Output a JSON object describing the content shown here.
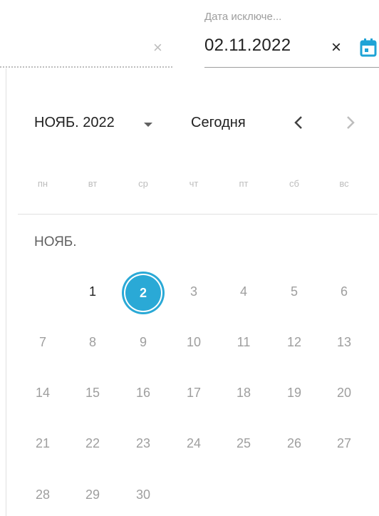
{
  "field": {
    "label": "Дата исключе...",
    "value": "02.11.2022",
    "clear_glyph": "×",
    "prev_clear_glyph": "×",
    "calendar_icon": "calendar-icon"
  },
  "picker": {
    "month_label": "НОЯБ. 2022",
    "today_label": "Сегодня",
    "prev_glyph": "‹",
    "next_glyph": "›",
    "weekdays": [
      "пн",
      "вт",
      "ср",
      "чт",
      "пт",
      "сб",
      "вс"
    ],
    "section_month": "НОЯБ.",
    "selected_day": "2",
    "days": [
      "1",
      "2",
      "3",
      "4",
      "5",
      "6",
      "7",
      "8",
      "9",
      "10",
      "11",
      "12",
      "13",
      "14",
      "15",
      "16",
      "17",
      "18",
      "19",
      "20",
      "21",
      "22",
      "23",
      "24",
      "25",
      "26",
      "27",
      "28",
      "29",
      "30"
    ]
  },
  "colors": {
    "accent": "#2aa9d6",
    "calendar_icon": "#1fa3d6"
  }
}
